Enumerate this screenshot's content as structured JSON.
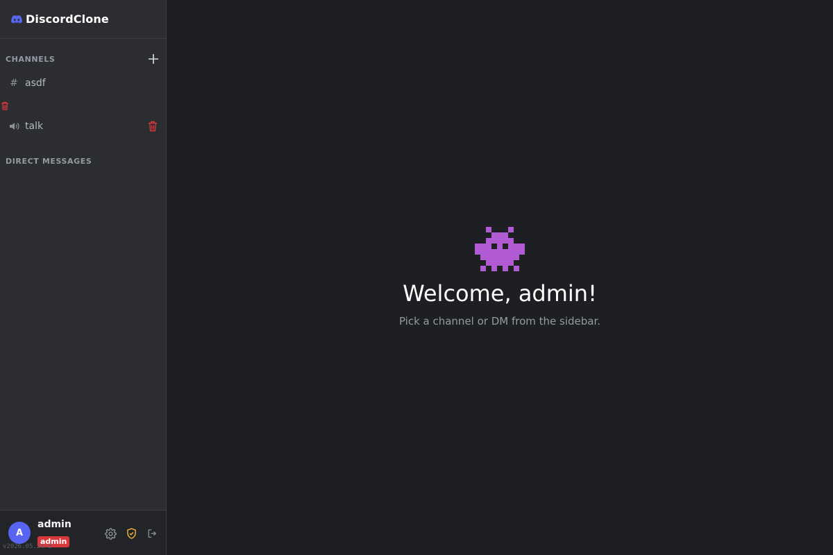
{
  "app": {
    "title": "DiscordClone"
  },
  "sidebar": {
    "channels_heading": "CHANNELS",
    "channels": [
      {
        "type": "text",
        "glyph": "#",
        "name": "asdf"
      },
      {
        "type": "voice",
        "glyph": "🔊",
        "name": "talk"
      }
    ],
    "dm_heading": "DIRECT MESSAGES"
  },
  "user": {
    "avatar_letter": "A",
    "name": "admin",
    "role": "admin",
    "version": "v2026.05.24-6"
  },
  "main": {
    "title": "Welcome, admin!",
    "subtitle": "Pick a channel or DM from the sidebar."
  },
  "colors": {
    "accent": "#5865f2",
    "danger": "#da373c",
    "shield": "#f0b232",
    "alien": "#b05bd4"
  },
  "icons": {
    "brand": "discord-logo-icon",
    "add": "plus-icon",
    "delete": "trash-icon",
    "settings": "gear-icon",
    "admin": "shield-check-icon",
    "logout": "logout-icon",
    "welcome": "alien-monster-icon"
  }
}
